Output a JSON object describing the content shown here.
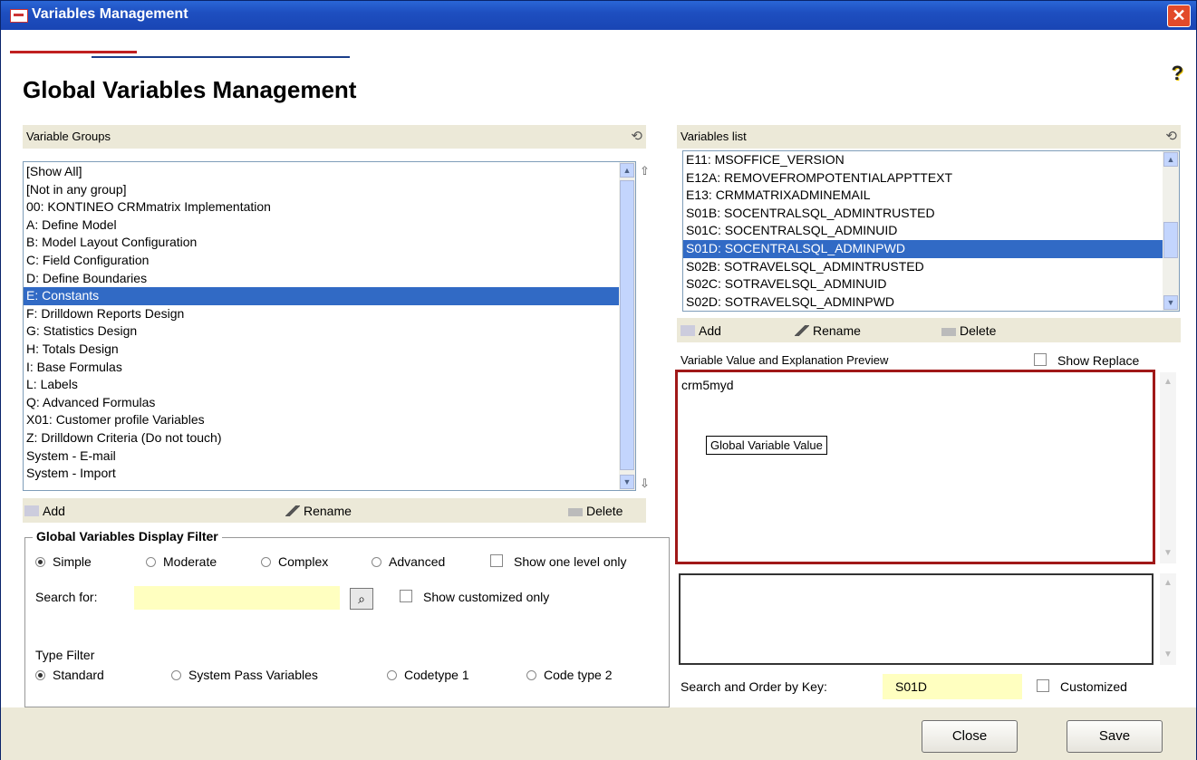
{
  "window": {
    "title": "Variables Management",
    "close_glyph": "✕"
  },
  "page_title": "Global Variables Management",
  "help_icon": "?",
  "variable_groups": {
    "header": "Variable Groups",
    "refresh_icon": "⟲",
    "items": [
      "[Show All]",
      "[Not in any group]",
      "00: KONTINEO CRMmatrix Implementation",
      "A: Define Model",
      "B: Model Layout Configuration",
      "C: Field Configuration",
      "D: Define Boundaries",
      "E: Constants",
      "F: Drilldown Reports Design",
      "G: Statistics Design",
      "H: Totals Design",
      "I: Base Formulas",
      "L: Labels",
      "Q: Advanced Formulas",
      "X01: Customer profile Variables",
      "Z: Drilldown Criteria (Do not touch)",
      "System - E-mail",
      "System - Import"
    ],
    "selected_index": 7,
    "add_label": "Add",
    "rename_label": "Rename",
    "delete_label": "Delete",
    "move_up_icon": "⇧",
    "move_down_icon": "⇩"
  },
  "variables_list": {
    "header": "Variables list",
    "refresh_icon": "⟲",
    "items": [
      "E11: MSOFFICE_VERSION",
      "E12A: REMOVEFROMPOTENTIALAPPTTEXT",
      "E13: CRMMATRIXADMINEMAIL",
      "S01B: SOCENTRALSQL_ADMINTRUSTED",
      "S01C: SOCENTRALSQL_ADMINUID",
      "S01D: SOCENTRALSQL_ADMINPWD",
      "S02B: SOTRAVELSQL_ADMINTRUSTED",
      "S02C: SOTRAVELSQL_ADMINUID",
      "S02D: SOTRAVELSQL_ADMINPWD"
    ],
    "selected_index": 5,
    "add_label": "Add",
    "rename_label": "Rename",
    "delete_label": "Delete"
  },
  "preview": {
    "header": "Variable Value and Explanation Preview",
    "show_replace_label": "Show Replace",
    "value_text": "crm5myd",
    "tooltip": "Global Variable Value"
  },
  "filter": {
    "legend": "Global Variables Display Filter",
    "level_options": [
      "Simple",
      "Moderate",
      "Complex",
      "Advanced"
    ],
    "level_selected": 0,
    "show_one_level_label": "Show one level only",
    "search_label": "Search for:",
    "search_value": "",
    "search_icon": "magnifier-icon",
    "show_customized_label": "Show customized only",
    "type_filter_label": "Type Filter",
    "type_options": [
      "Standard",
      "System Pass Variables",
      "Codetype 1",
      "Code type 2"
    ],
    "type_selected": 0
  },
  "key_search": {
    "label": "Search and Order by Key:",
    "value": "S01D",
    "customized_label": "Customized"
  },
  "buttons": {
    "close": "Close",
    "save": "Save"
  },
  "colors": {
    "titlebar": "#1e4fc0",
    "selection": "#316ac5",
    "accent_red": "#c02020",
    "highlight_border": "#a01818",
    "input_yellow": "#ffffc0",
    "panel_bg": "#ece9d8"
  }
}
